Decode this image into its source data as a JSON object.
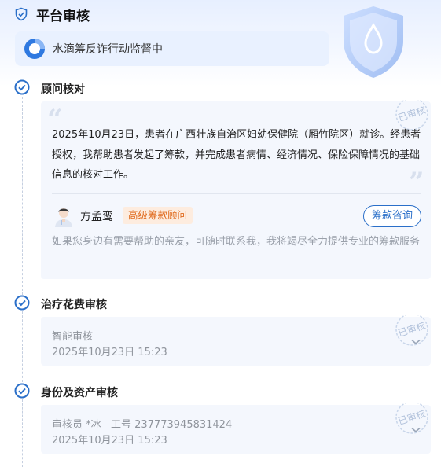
{
  "header": {
    "title": "平台审核"
  },
  "banner": {
    "text": "水滴筹反诈行动监督中"
  },
  "steps": [
    {
      "title": "顾问核对",
      "stamp": "已审核",
      "paragraph": "2025年10月23日，患者在广西壮族自治区妇幼保健院（厢竹院区）就诊。经患者授权，我帮助患者发起了筹款，并完成患者病情、经济情况、保险保障情况的基础信息的核对工作。",
      "advisor": {
        "name": "方孟鸾",
        "badge": "高级筹款顾问",
        "button": "筹款咨询",
        "note": "如果您身边有需要帮助的亲友，可随时联系我，我将竭尽全力提供专业的筹款服务"
      }
    },
    {
      "title": "治疗花费审核",
      "stamp": "已审核",
      "line1": "智能审核",
      "line2": "2025年10月23日 15:23"
    },
    {
      "title": "身份及资产审核",
      "stamp": "已审核",
      "line1": "审核员 *冰   工号 237773945831424",
      "line2": "2025年10月23日 15:23"
    }
  ],
  "colors": {
    "accent": "#2a6fc9",
    "badge_bg": "#fdecdf",
    "badge_text": "#e06a1d"
  },
  "icons": [
    "shield-check-icon",
    "water-drop-icon",
    "check-circle-icon",
    "approved-stamp-icon",
    "chevron-down-icon",
    "quote-icon",
    "advisor-avatar"
  ]
}
